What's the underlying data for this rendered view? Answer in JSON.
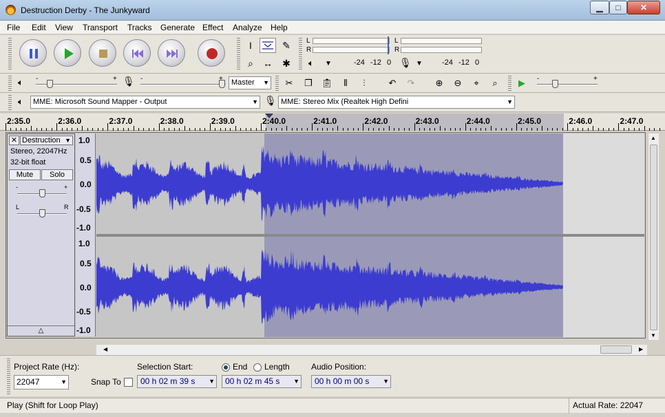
{
  "window": {
    "title": "Destruction Derby - The Junkyward",
    "min_icon": "minimize-icon",
    "max_icon": "maximize-icon",
    "close_icon": "close-icon"
  },
  "menu": [
    "File",
    "Edit",
    "View",
    "Transport",
    "Tracks",
    "Generate",
    "Effect",
    "Analyze",
    "Help"
  ],
  "meters": {
    "playback": {
      "left": "L",
      "right": "R",
      "ticks": [
        "-24",
        "-12",
        "0"
      ]
    },
    "record": {
      "left": "L",
      "right": "R",
      "ticks": [
        "-24",
        "-12",
        "0"
      ]
    }
  },
  "mixer": {
    "source": "Master"
  },
  "devices": {
    "output": "MME: Microsoft Sound Mapper - Output",
    "input": "MME: Stereo Mix (Realtek High Defini"
  },
  "ruler": {
    "labels": [
      "2:35.0",
      "2:36.0",
      "2:37.0",
      "2:38.0",
      "2:39.0",
      "2:40.0",
      "2:41.0",
      "2:42.0",
      "2:43.0",
      "2:44.0",
      "2:45.0",
      "2:46.0",
      "2:47.0"
    ]
  },
  "track": {
    "name": "Destruction",
    "info1": "Stereo, 22047Hz",
    "info2": "32-bit float",
    "mute": "Mute",
    "solo": "Solo",
    "close": "✕",
    "gain_minus": "-",
    "gain_plus": "+",
    "pan_left": "L",
    "pan_right": "R",
    "scale": [
      "1.0",
      "0.5",
      "0.0",
      "-0.5",
      "-1.0"
    ]
  },
  "bottom": {
    "project_rate_label": "Project Rate (Hz):",
    "project_rate": "22047",
    "snap_to": "Snap To",
    "selection_start_label": "Selection Start:",
    "end_label": "End",
    "length_label": "Length",
    "audio_position_label": "Audio Position:",
    "selection_start": "00 h 02 m 39 s",
    "selection_end": "00 h 02 m 45 s",
    "audio_position": "00 h 00 m 00 s"
  },
  "status": {
    "left": "Play (Shift for Loop Play)",
    "right": "Actual Rate: 22047"
  }
}
